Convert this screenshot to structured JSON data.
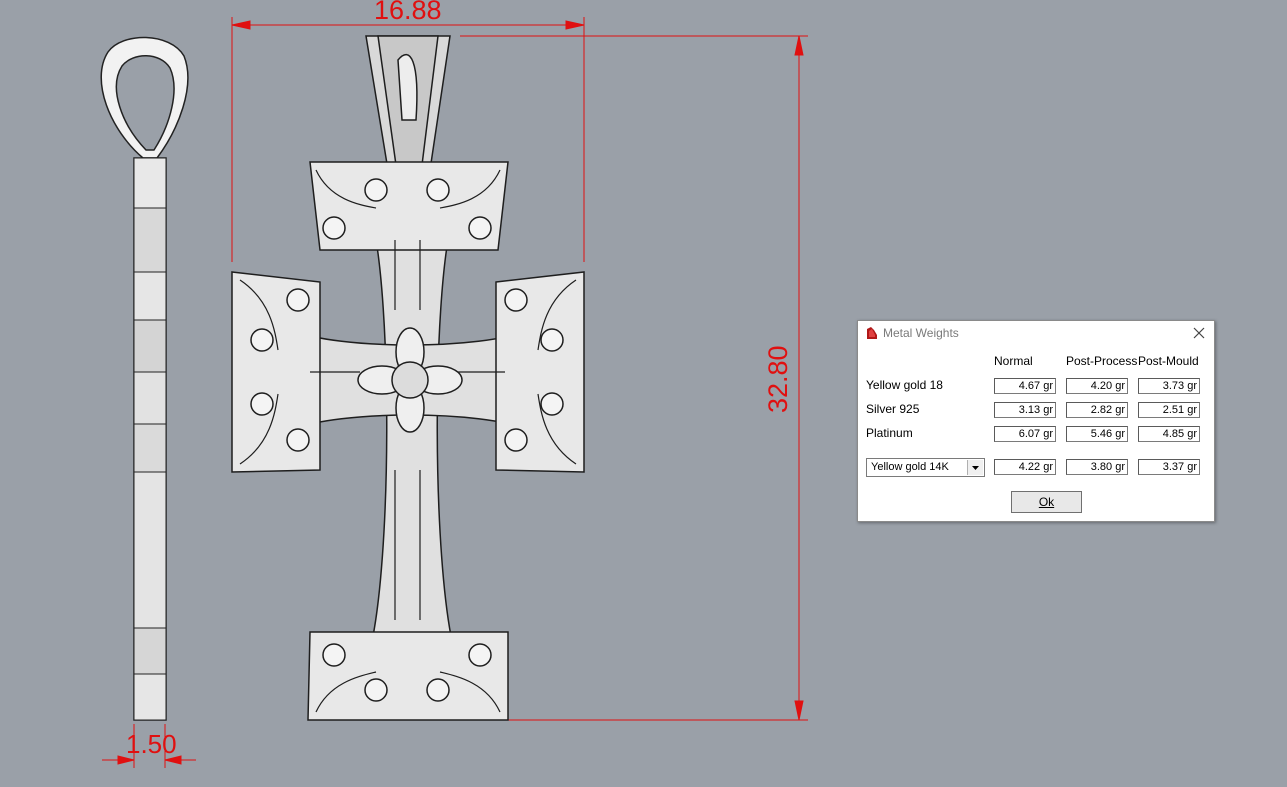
{
  "viewport": {
    "dimensions": {
      "width_label": "16.88",
      "height_label": "32.80",
      "thickness_label": "1.50"
    },
    "colors": {
      "background": "#9aa0a8",
      "dimension": "#e01010",
      "model_fill": "#e6e6e6",
      "model_outline": "#222222"
    }
  },
  "dialog": {
    "title": "Metal Weights",
    "app_icon": "rhino-app-icon",
    "close_icon": "close-icon",
    "columns": [
      "Normal",
      "Post-Process",
      "Post-Mould"
    ],
    "rows": [
      {
        "label": "Yellow gold 18",
        "values": [
          "4.67 gr",
          "4.20 gr",
          "3.73 gr"
        ]
      },
      {
        "label": "Silver 925",
        "values": [
          "3.13 gr",
          "2.82 gr",
          "2.51 gr"
        ]
      },
      {
        "label": "Platinum",
        "values": [
          "6.07 gr",
          "5.46 gr",
          "4.85 gr"
        ]
      }
    ],
    "custom_row": {
      "selected_metal": "Yellow gold 14K",
      "values": [
        "4.22 gr",
        "3.80 gr",
        "3.37 gr"
      ]
    },
    "ok_label": "Ok"
  }
}
